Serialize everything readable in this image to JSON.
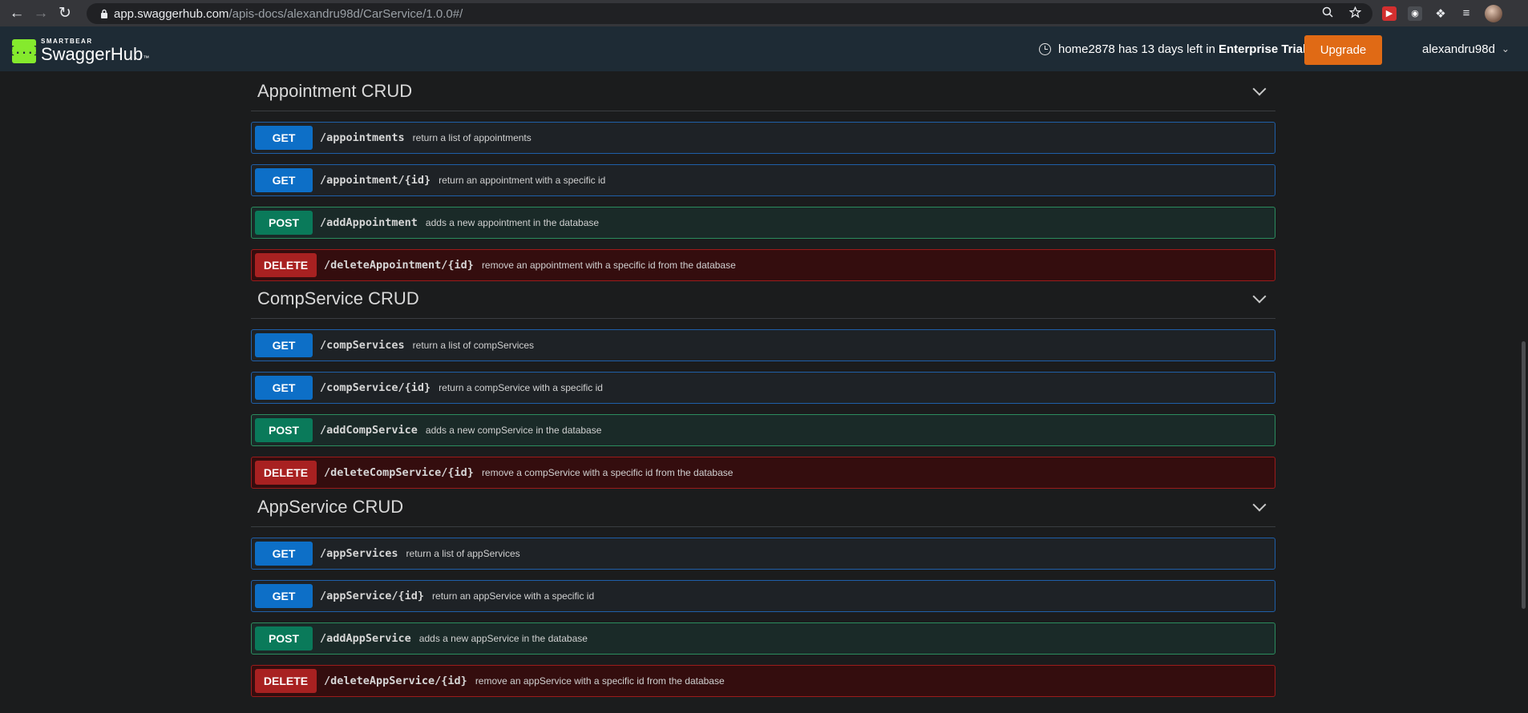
{
  "browser": {
    "url_host": "app.swaggerhub.com",
    "url_path": "/apis-docs/alexandru98d/CarService/1.0.0#/"
  },
  "header": {
    "logo_small": "SMARTBEAR",
    "logo_big": "SwaggerHub",
    "logo_tm": "™",
    "trial_text": "home2878 has 13 days left in",
    "trial_plan": "Enterprise Trial",
    "upgrade_label": "Upgrade",
    "username": "alexandru98d"
  },
  "sections": [
    {
      "title": "Appointment CRUD",
      "ops": [
        {
          "method": "GET",
          "path": "/appointments",
          "desc": "return a list of appointments"
        },
        {
          "method": "GET",
          "path": "/appointment/{id}",
          "desc": "return an appointment with a specific id"
        },
        {
          "method": "POST",
          "path": "/addAppointment",
          "desc": "adds a new appointment in the database"
        },
        {
          "method": "DELETE",
          "path": "/deleteAppointment/{id}",
          "desc": "remove an appointment with a specific id from the database"
        }
      ]
    },
    {
      "title": "CompService CRUD",
      "ops": [
        {
          "method": "GET",
          "path": "/compServices",
          "desc": "return a list of compServices"
        },
        {
          "method": "GET",
          "path": "/compService/{id}",
          "desc": "return a compService with a specific id"
        },
        {
          "method": "POST",
          "path": "/addCompService",
          "desc": "adds a new compService in the database"
        },
        {
          "method": "DELETE",
          "path": "/deleteCompService/{id}",
          "desc": "remove a compService with a specific id from the database"
        }
      ]
    },
    {
      "title": "AppService CRUD",
      "ops": [
        {
          "method": "GET",
          "path": "/appServices",
          "desc": "return a list of appServices"
        },
        {
          "method": "GET",
          "path": "/appService/{id}",
          "desc": "return an appService with a specific id"
        },
        {
          "method": "POST",
          "path": "/addAppService",
          "desc": "adds a new appService in the database"
        },
        {
          "method": "DELETE",
          "path": "/deleteAppService/{id}",
          "desc": "remove an appService with a specific id from the database"
        }
      ]
    }
  ],
  "colors": {
    "get": "#0d6fc7",
    "post": "#0a7a5a",
    "delete": "#a82121",
    "upgrade": "#e06a15",
    "brand": "#85ea2d"
  }
}
